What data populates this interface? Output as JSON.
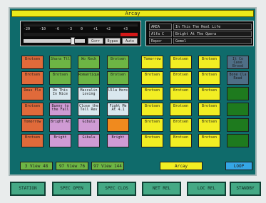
{
  "screen": {
    "title": "Arcay"
  },
  "meter": {
    "scale": [
      "-20",
      "-10",
      "-6",
      "-3",
      "0",
      "+1",
      "+2",
      "+3"
    ],
    "buttons": [
      "Corr",
      "Bypas",
      "Auto"
    ]
  },
  "info": {
    "rows": [
      {
        "key": "AREA",
        "value": "In This The Real Life"
      },
      {
        "key": "Alfa C",
        "value": "Bright At The Opera"
      },
      {
        "key": "Repor",
        "value": "Gemel"
      }
    ]
  },
  "carts": {
    "col1": [
      {
        "label": "Brotsen",
        "color": "#e06a3a"
      },
      {
        "label": "Brotsen",
        "color": "#e06a3a"
      },
      {
        "label": "Deus Flx",
        "color": "#e06a3a"
      },
      {
        "label": "Brotsen",
        "color": "#e06a3a"
      },
      {
        "label": "Tomorrow",
        "color": "#e06a3a"
      },
      {
        "label": "Brotsen",
        "color": "#e06a3a"
      }
    ],
    "col2": [
      {
        "label": "Shara Ttl",
        "color": "#6db544"
      },
      {
        "label": "Brotsen",
        "color": "#6db544"
      },
      {
        "label": "Do This In Nice",
        "color": "#d9e7ee"
      },
      {
        "label": "Bunny to the Fall",
        "color": "#cf9bd4"
      },
      {
        "label": "Bright At",
        "color": "#cf9bd4"
      },
      {
        "label": "Bright",
        "color": "#cf9bd4"
      }
    ],
    "col3": [
      {
        "label": "Wo Rock",
        "color": "#6db544"
      },
      {
        "label": "Romantique",
        "color": "#6db544"
      },
      {
        "label": "Masculin Loving",
        "color": "#d9e7ee"
      },
      {
        "label": "Close the Tell Rev",
        "color": "#d9e7ee"
      },
      {
        "label": "Gibulu",
        "color": "#cf9bd4"
      },
      {
        "label": "Gibulu",
        "color": "#cf9bd4"
      }
    ],
    "col4": [
      {
        "label": "Brotsen",
        "color": "#6db544"
      },
      {
        "label": "Brotsen",
        "color": "#6db544"
      },
      {
        "label": "Ulla Here",
        "color": "#d9e7ee"
      },
      {
        "label": "Fight Me At 4.1",
        "color": "#d9e7ee"
      },
      {
        "label": "",
        "color": "#f08a1e"
      },
      {
        "label": "Bright",
        "color": "#cf9bd4"
      }
    ],
    "col5": [
      {
        "label": "Tomorrow",
        "color": "#f2ee23"
      },
      {
        "label": "Brotsen",
        "color": "#f2ee23"
      },
      {
        "label": "Brotsen",
        "color": "#f2ee23"
      },
      {
        "label": "Brotsen",
        "color": "#f2ee23"
      },
      {
        "label": "Brotsen",
        "color": "#f2ee23"
      },
      {
        "label": "Brotsen",
        "color": "#f2ee23"
      }
    ],
    "col6": [
      {
        "label": "Brotsen",
        "color": "#f2ee23"
      },
      {
        "label": "Brotsen",
        "color": "#f2ee23"
      },
      {
        "label": "Brotsen",
        "color": "#f2ee23"
      },
      {
        "label": "Brotsen",
        "color": "#f2ee23"
      },
      {
        "label": "Brotsen",
        "color": "#f2ee23"
      },
      {
        "label": "Brotsen",
        "color": "#f2ee23"
      }
    ],
    "col7": [
      {
        "label": "Brotsen",
        "color": "#f2ee23"
      },
      {
        "label": "Brotsen",
        "color": "#f2ee23"
      },
      {
        "label": "Brotsen",
        "color": "#f2ee23"
      },
      {
        "label": "Brotsen",
        "color": "#f2ee23"
      },
      {
        "label": "Brotsen",
        "color": "#f2ee23"
      },
      {
        "label": "Brotsen",
        "color": "#f2ee23"
      }
    ],
    "col8": [
      {
        "label": "It Co Case Brood",
        "color": "#4f6f86"
      },
      {
        "label": "Bone Cla Read",
        "color": "#4f6f86"
      },
      {
        "label": "",
        "color": "#1e7a1e"
      },
      {
        "label": "",
        "color": "#1e7a1e"
      },
      {
        "label": "",
        "color": "#1e7a1e"
      },
      {
        "label": "",
        "color": "#1e7a1e"
      }
    ]
  },
  "tabs": [
    {
      "label": "3 View 48",
      "color": "#6db544"
    },
    {
      "label": "97 View 76",
      "color": "#6db544"
    },
    {
      "label": "97 View 144",
      "color": "#6db544"
    },
    {
      "label": "Arcay",
      "color": "#f2ee23"
    },
    {
      "label": "LOOP",
      "color": "#35a6e6"
    }
  ],
  "footer": {
    "buttons": [
      "STATION",
      "SPEC OPEN",
      "SPEC CLOS",
      "NET REL",
      "LOC REL",
      "STANDBY"
    ]
  }
}
